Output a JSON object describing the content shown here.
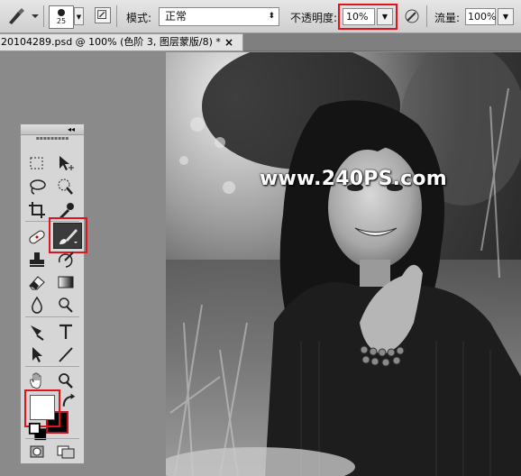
{
  "options_bar": {
    "brush_size": "25",
    "mode_label": "模式:",
    "mode_value": "正常",
    "opacity_label": "不透明度:",
    "opacity_value": "10%",
    "flow_label": "流量:",
    "flow_value": "100%"
  },
  "document_tab": {
    "title": "20104289.psd @ 100% (色阶 3, 图层蒙版/8) *",
    "close_glyph": "×"
  },
  "canvas": {
    "watermark": "www.240PS.com",
    "image_style": "grayscale"
  },
  "toolbox": {
    "collapse_glyph": "◂◂",
    "tools": [
      "marquee-icon",
      "move-icon",
      "lasso-icon",
      "quick-select-icon",
      "crop-icon",
      "eyedropper-icon",
      "healing-brush-icon",
      "brush-icon",
      "clone-stamp-icon",
      "history-brush-icon",
      "eraser-icon",
      "gradient-icon",
      "blur-icon",
      "dodge-icon",
      "pen-icon",
      "type-icon",
      "path-select-icon",
      "line-icon",
      "hand-icon",
      "zoom-icon"
    ],
    "active_tool": "brush-icon",
    "foreground_color": "#ffffff",
    "background_color": "#000000"
  },
  "colors": {
    "highlight": "#e0141c"
  }
}
